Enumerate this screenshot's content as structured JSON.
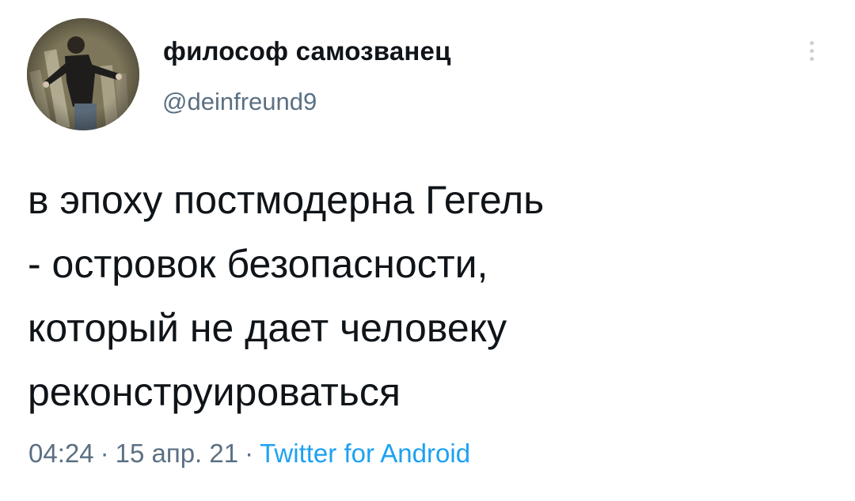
{
  "tweet": {
    "author": {
      "display_name": "философ самозванец",
      "handle": "@deinfreund9",
      "avatar_icon": "profile-photo"
    },
    "more_icon": "vertical-ellipsis-icon",
    "text_lines": [
      "в эпоху постмодерна Гегель",
      "- островок безопасности,",
      "который не дает человеку",
      "реконструироваться"
    ],
    "meta": {
      "time": "04:24",
      "separator": "·",
      "date": "15 апр. 21",
      "source": "Twitter for Android"
    }
  },
  "colors": {
    "text": "#0f1419",
    "secondary": "#5b7083",
    "link": "#1da1f2",
    "background": "#ffffff"
  }
}
